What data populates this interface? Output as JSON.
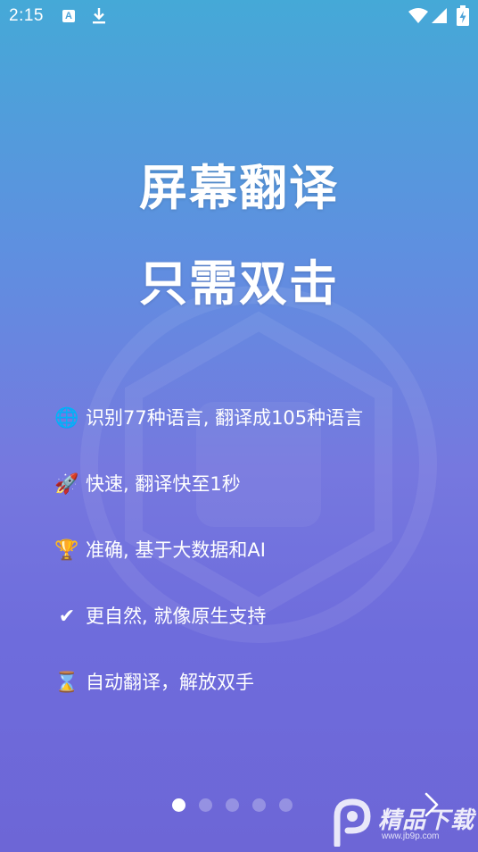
{
  "status_bar": {
    "time": "2:15",
    "icons": [
      "a-notification-icon",
      "download-icon",
      "wifi-icon",
      "signal-icon",
      "battery-charging-icon"
    ],
    "a_icon_text": "A"
  },
  "headline": {
    "line1": "屏幕翻译",
    "line2": "只需双击"
  },
  "features": [
    {
      "icon": "globe-icon",
      "glyph": "🌐",
      "text": "识别77种语言, 翻译成105种语言"
    },
    {
      "icon": "rocket-icon",
      "glyph": "🚀",
      "text": "快速, 翻译快至1秒"
    },
    {
      "icon": "trophy-icon",
      "glyph": "🏆",
      "text": "准确, 基于大数据和AI"
    },
    {
      "icon": "check-mark-icon",
      "glyph": "✔",
      "text": "更自然, 就像原生支持"
    },
    {
      "icon": "hourglass-icon",
      "glyph": "⌛",
      "text": "自动翻译，解放双手"
    }
  ],
  "pager": {
    "total": 5,
    "active_index": 0
  },
  "watermark": {
    "title": "精品下载",
    "url": "www.jb9p.com"
  },
  "colors": {
    "gradient_top": "#45a9d7",
    "gradient_bottom": "#6d66d6",
    "text": "#ffffff"
  }
}
